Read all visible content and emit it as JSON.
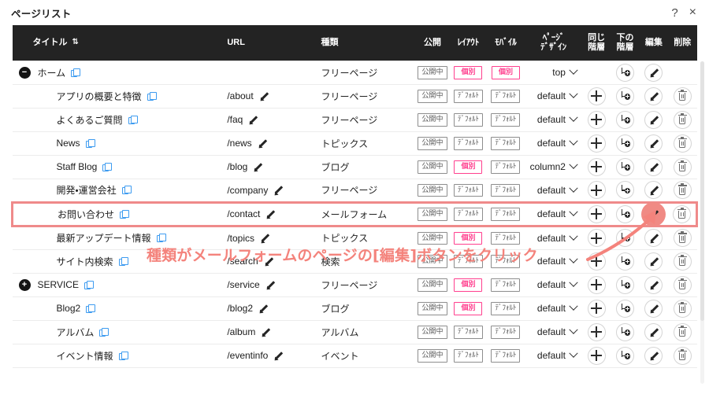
{
  "window": {
    "title": "ページリスト",
    "help_icon": "?",
    "close_icon": "×"
  },
  "table": {
    "columns": {
      "title": "タイトル",
      "title_sort_icon": "⇅",
      "url": "URL",
      "type": "種類",
      "publish": "公開",
      "layout": "ﾚｲｱｳﾄ",
      "mobile": "ﾓﾊﾞｲﾙ",
      "design_line1": "ﾍﾟｰｼﾞ",
      "design_line2": "ﾃﾞｻﾞｲﾝ",
      "same_line1": "同じ",
      "same_line2": "階層",
      "under_line1": "下の",
      "under_line2": "階層",
      "edit": "編集",
      "delete": "削除"
    },
    "rows": [
      {
        "title": "ホーム",
        "indent": 0,
        "toggle": "−",
        "url": "",
        "type": "フリーページ",
        "publish": "公開中",
        "layout": "個別",
        "layout_pink": true,
        "mobile": "個別",
        "mobile_pink": true,
        "design": "top",
        "has_same": false,
        "has_under": true,
        "has_edit": true,
        "has_delete": false,
        "highlight": false,
        "edit_halo": false
      },
      {
        "title": "アプリの概要と特徴",
        "indent": 1,
        "toggle": "",
        "url": "/about",
        "type": "フリーページ",
        "publish": "公開中",
        "layout": "ﾃﾞﾌｫﾙﾄ",
        "layout_pink": false,
        "mobile": "ﾃﾞﾌｫﾙﾄ",
        "mobile_pink": false,
        "design": "default",
        "has_same": true,
        "has_under": true,
        "has_edit": true,
        "has_delete": true,
        "highlight": false,
        "edit_halo": false
      },
      {
        "title": "よくあるご質問",
        "indent": 1,
        "toggle": "",
        "url": "/faq",
        "type": "フリーページ",
        "publish": "公開中",
        "layout": "ﾃﾞﾌｫﾙﾄ",
        "layout_pink": false,
        "mobile": "ﾃﾞﾌｫﾙﾄ",
        "mobile_pink": false,
        "design": "default",
        "has_same": true,
        "has_under": true,
        "has_edit": true,
        "has_delete": true,
        "highlight": false,
        "edit_halo": false
      },
      {
        "title": "News",
        "indent": 1,
        "toggle": "",
        "url": "/news",
        "type": "トピックス",
        "publish": "公開中",
        "layout": "ﾃﾞﾌｫﾙﾄ",
        "layout_pink": false,
        "mobile": "ﾃﾞﾌｫﾙﾄ",
        "mobile_pink": false,
        "design": "default",
        "has_same": true,
        "has_under": true,
        "has_edit": true,
        "has_delete": true,
        "highlight": false,
        "edit_halo": false
      },
      {
        "title": "Staff Blog",
        "indent": 1,
        "toggle": "",
        "url": "/blog",
        "type": "ブログ",
        "publish": "公開中",
        "layout": "個別",
        "layout_pink": true,
        "mobile": "ﾃﾞﾌｫﾙﾄ",
        "mobile_pink": false,
        "design": "column2",
        "has_same": true,
        "has_under": true,
        "has_edit": true,
        "has_delete": true,
        "highlight": false,
        "edit_halo": false
      },
      {
        "title": "開発・運営会社",
        "indent": 1,
        "toggle": "",
        "url": "/company",
        "type": "フリーページ",
        "publish": "公開中",
        "layout": "ﾃﾞﾌｫﾙﾄ",
        "layout_pink": false,
        "mobile": "ﾃﾞﾌｫﾙﾄ",
        "mobile_pink": false,
        "design": "default",
        "has_same": true,
        "has_under": true,
        "has_edit": true,
        "has_delete": true,
        "highlight": false,
        "edit_halo": false
      },
      {
        "title": "お問い合わせ",
        "indent": 1,
        "toggle": "",
        "url": "/contact",
        "type": "メールフォーム",
        "publish": "公開中",
        "layout": "ﾃﾞﾌｫﾙﾄ",
        "layout_pink": false,
        "mobile": "ﾃﾞﾌｫﾙﾄ",
        "mobile_pink": false,
        "design": "default",
        "has_same": true,
        "has_under": true,
        "has_edit": true,
        "has_delete": true,
        "highlight": true,
        "edit_halo": true
      },
      {
        "title": "最新アップデート情報",
        "indent": 1,
        "toggle": "",
        "url": "/topics",
        "type": "トピックス",
        "publish": "公開中",
        "layout": "個別",
        "layout_pink": true,
        "mobile": "ﾃﾞﾌｫﾙﾄ",
        "mobile_pink": false,
        "design": "default",
        "has_same": true,
        "has_under": true,
        "has_edit": true,
        "has_delete": true,
        "highlight": false,
        "edit_halo": false
      },
      {
        "title": "サイト内検索",
        "indent": 1,
        "toggle": "",
        "url": "/search",
        "type": "検索",
        "publish": "公開中",
        "layout": "ﾃﾞﾌｫﾙﾄ",
        "layout_pink": false,
        "mobile": "ﾃﾞﾌｫﾙﾄ",
        "mobile_pink": false,
        "design": "default",
        "has_same": true,
        "has_under": true,
        "has_edit": true,
        "has_delete": true,
        "highlight": false,
        "edit_halo": false
      },
      {
        "title": "SERVICE",
        "indent": 0,
        "toggle": "+",
        "url": "/service",
        "type": "フリーページ",
        "publish": "公開中",
        "layout": "個別",
        "layout_pink": true,
        "mobile": "ﾃﾞﾌｫﾙﾄ",
        "mobile_pink": false,
        "design": "default",
        "has_same": true,
        "has_under": true,
        "has_edit": true,
        "has_delete": true,
        "highlight": false,
        "edit_halo": false
      },
      {
        "title": "Blog2",
        "indent": 1,
        "toggle": "",
        "url": "/blog2",
        "type": "ブログ",
        "publish": "公開中",
        "layout": "個別",
        "layout_pink": true,
        "mobile": "ﾃﾞﾌｫﾙﾄ",
        "mobile_pink": false,
        "design": "default",
        "has_same": true,
        "has_under": true,
        "has_edit": true,
        "has_delete": true,
        "highlight": false,
        "edit_halo": false
      },
      {
        "title": "アルバム",
        "indent": 1,
        "toggle": "",
        "url": "/album",
        "type": "アルバム",
        "publish": "公開中",
        "layout": "ﾃﾞﾌｫﾙﾄ",
        "layout_pink": false,
        "mobile": "ﾃﾞﾌｫﾙﾄ",
        "mobile_pink": false,
        "design": "default",
        "has_same": true,
        "has_under": true,
        "has_edit": true,
        "has_delete": true,
        "highlight": false,
        "edit_halo": false
      },
      {
        "title": "イベント情報",
        "indent": 1,
        "toggle": "",
        "url": "/eventinfo",
        "type": "イベント",
        "publish": "公開中",
        "layout": "ﾃﾞﾌｫﾙﾄ",
        "layout_pink": false,
        "mobile": "ﾃﾞﾌｫﾙﾄ",
        "mobile_pink": false,
        "design": "default",
        "has_same": true,
        "has_under": true,
        "has_edit": true,
        "has_delete": true,
        "highlight": false,
        "edit_halo": false
      }
    ]
  },
  "annotation": {
    "text": "種類がメールフォームのページの[編集]ボタンをクリック"
  },
  "colors": {
    "header_bg": "#232323",
    "accent_pink": "#ff3f8e",
    "annotation": "#f4837c",
    "highlight_border": "#ef8a8a",
    "halo": "#f08a84",
    "copy_icon": "#3d9bf0"
  }
}
